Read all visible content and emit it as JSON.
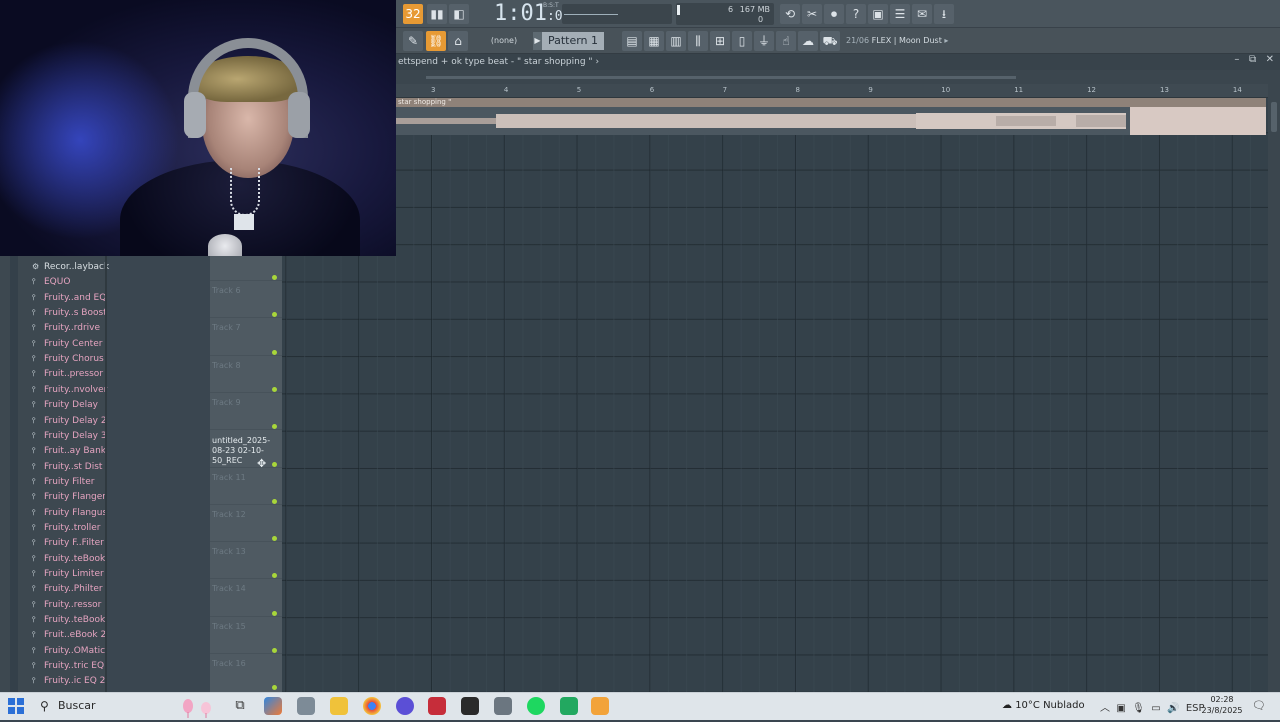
{
  "toolbar": {
    "time": "1:01",
    "time_sub": ":00",
    "bst": "B:S:T",
    "memory": "167 MB",
    "cpu_value": "6",
    "cpu_poly": "0",
    "pattern_select": "(none)",
    "pattern_name": "Pattern 1",
    "preset_index": "21/06",
    "preset_name": "FLEX | Moon Dust",
    "mode_badge": "32"
  },
  "playlist": {
    "title_breadcrumb": "ettspend + ok type beat ‐ \" star shopping \"",
    "clip_name": "star shopping \"",
    "ruler": [
      "3",
      "4",
      "5",
      "6",
      "7",
      "8",
      "9",
      "10",
      "11",
      "12",
      "13",
      "14"
    ],
    "tracks": [
      "Track 6",
      "Track 7",
      "Track 8",
      "Track 9",
      "",
      "Track 11",
      "Track 12",
      "Track 13",
      "Track 14",
      "Track 15",
      "Track 16"
    ],
    "recording_clip": "untitled_2025-08-23 02-10-50_REC"
  },
  "browser": {
    "items": [
      "Recor..layback",
      "EQUO",
      "Fruity..and EQ",
      "Fruity..s Boost",
      "Fruity..rdrive",
      "Fruity Center",
      "Fruity Chorus",
      "Fruit..pressor",
      "Fruity..nvolver",
      "Fruity Delay",
      "Fruity Delay 2",
      "Fruity Delay 3",
      "Fruit..ay Bank",
      "Fruity..st Dist",
      "Fruity Filter",
      "Fruity Flanger",
      "Fruity Flangus",
      "Fruity..troller",
      "Fruity F..Filter",
      "Fruity..teBook",
      "Fruity Limiter",
      "Fruity..Philter",
      "Fruity..ressor",
      "Fruity..teBook",
      "Fruit..eBook 2",
      "Fruity..OMatic",
      "Fruity..tric EQ",
      "Fruity..ic EQ 2"
    ]
  },
  "taskbar": {
    "search_placeholder": "Buscar",
    "weather": "10°C  Nublado",
    "language": "ESP",
    "time": "02:28",
    "date": "23/8/2025"
  }
}
